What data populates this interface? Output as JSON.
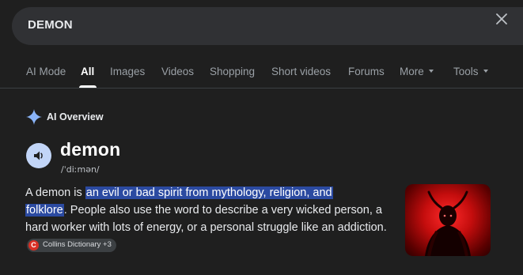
{
  "search": {
    "query": "DEMON"
  },
  "tabs": [
    {
      "label": "AI Mode"
    },
    {
      "label": "All"
    },
    {
      "label": "Images"
    },
    {
      "label": "Videos"
    },
    {
      "label": "Shopping"
    },
    {
      "label": "Short videos"
    },
    {
      "label": "Forums"
    },
    {
      "label": "More"
    },
    {
      "label": "Tools"
    }
  ],
  "ai_overview": {
    "title": "AI Overview",
    "word": "demon",
    "phonetic": "/ˈdiːmən/",
    "definition": {
      "prefix": "A demon is ",
      "highlight_1": "an evil or bad spirit from mythology, religion, and",
      "highlight_2": "folklore",
      "rest": ". People also use the word to describe a very wicked person, a hard worker with lots of energy, or a personal struggle like an addiction."
    },
    "source": {
      "logo_letter": "C",
      "label": "Collins Dictionary +3"
    }
  },
  "colors": {
    "background": "#1f1f1f",
    "search_bar": "#303134",
    "highlight": "#2b4aa1",
    "speaker_button": "#c2d5f7",
    "ai_sparkle": "#8ab4f8",
    "source_logo": "#d93025"
  },
  "icons": {
    "clear": "close-icon",
    "ai": "sparkle-icon",
    "speaker": "speaker-icon"
  }
}
